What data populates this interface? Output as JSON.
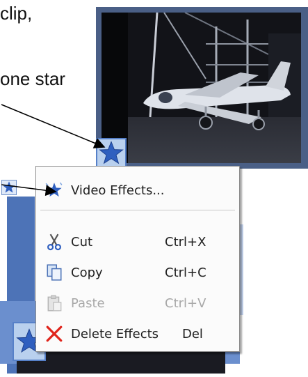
{
  "document": {
    "line1": "clip,",
    "line2": "one star"
  },
  "context_menu": {
    "items": [
      {
        "label": "Video Effects...",
        "shortcut": "",
        "icon": "star-effects-icon",
        "enabled": true
      },
      {
        "label": "Cut",
        "shortcut": "Ctrl+X",
        "icon": "scissors-icon",
        "enabled": true
      },
      {
        "label": "Copy",
        "shortcut": "Ctrl+C",
        "icon": "copy-icon",
        "enabled": true
      },
      {
        "label": "Paste",
        "shortcut": "Ctrl+V",
        "icon": "paste-icon",
        "enabled": false
      },
      {
        "label": "Delete Effects",
        "shortcut": "Del",
        "icon": "red-x-icon",
        "enabled": true
      }
    ]
  },
  "colors": {
    "frame_blue": "#4a5f86",
    "badge_bg": "#b9d0ee",
    "star_blue": "#2f5fbf",
    "delete_red": "#e0241b"
  }
}
